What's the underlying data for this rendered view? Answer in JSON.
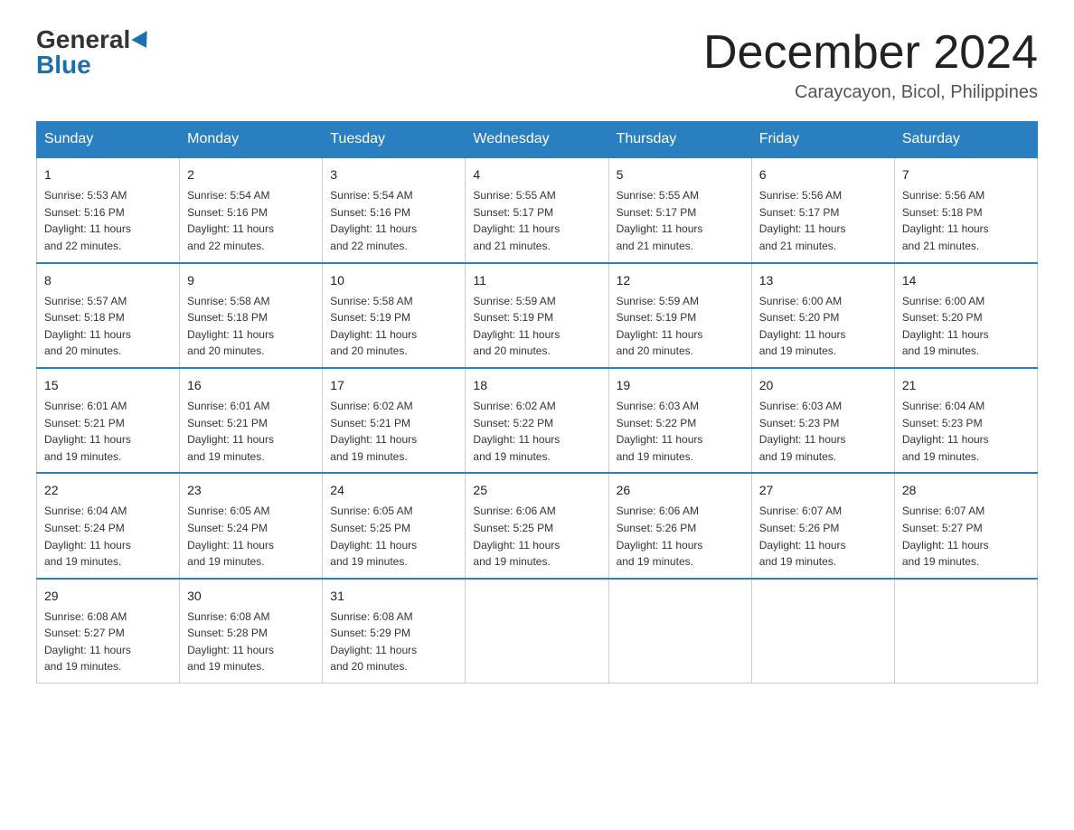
{
  "logo": {
    "general": "General",
    "blue": "Blue"
  },
  "title": "December 2024",
  "location": "Caraycayon, Bicol, Philippines",
  "days_of_week": [
    "Sunday",
    "Monday",
    "Tuesday",
    "Wednesday",
    "Thursday",
    "Friday",
    "Saturday"
  ],
  "weeks": [
    [
      {
        "day": "1",
        "sunrise": "5:53 AM",
        "sunset": "5:16 PM",
        "daylight": "11 hours and 22 minutes."
      },
      {
        "day": "2",
        "sunrise": "5:54 AM",
        "sunset": "5:16 PM",
        "daylight": "11 hours and 22 minutes."
      },
      {
        "day": "3",
        "sunrise": "5:54 AM",
        "sunset": "5:16 PM",
        "daylight": "11 hours and 22 minutes."
      },
      {
        "day": "4",
        "sunrise": "5:55 AM",
        "sunset": "5:17 PM",
        "daylight": "11 hours and 21 minutes."
      },
      {
        "day": "5",
        "sunrise": "5:55 AM",
        "sunset": "5:17 PM",
        "daylight": "11 hours and 21 minutes."
      },
      {
        "day": "6",
        "sunrise": "5:56 AM",
        "sunset": "5:17 PM",
        "daylight": "11 hours and 21 minutes."
      },
      {
        "day": "7",
        "sunrise": "5:56 AM",
        "sunset": "5:18 PM",
        "daylight": "11 hours and 21 minutes."
      }
    ],
    [
      {
        "day": "8",
        "sunrise": "5:57 AM",
        "sunset": "5:18 PM",
        "daylight": "11 hours and 20 minutes."
      },
      {
        "day": "9",
        "sunrise": "5:58 AM",
        "sunset": "5:18 PM",
        "daylight": "11 hours and 20 minutes."
      },
      {
        "day": "10",
        "sunrise": "5:58 AM",
        "sunset": "5:19 PM",
        "daylight": "11 hours and 20 minutes."
      },
      {
        "day": "11",
        "sunrise": "5:59 AM",
        "sunset": "5:19 PM",
        "daylight": "11 hours and 20 minutes."
      },
      {
        "day": "12",
        "sunrise": "5:59 AM",
        "sunset": "5:19 PM",
        "daylight": "11 hours and 20 minutes."
      },
      {
        "day": "13",
        "sunrise": "6:00 AM",
        "sunset": "5:20 PM",
        "daylight": "11 hours and 19 minutes."
      },
      {
        "day": "14",
        "sunrise": "6:00 AM",
        "sunset": "5:20 PM",
        "daylight": "11 hours and 19 minutes."
      }
    ],
    [
      {
        "day": "15",
        "sunrise": "6:01 AM",
        "sunset": "5:21 PM",
        "daylight": "11 hours and 19 minutes."
      },
      {
        "day": "16",
        "sunrise": "6:01 AM",
        "sunset": "5:21 PM",
        "daylight": "11 hours and 19 minutes."
      },
      {
        "day": "17",
        "sunrise": "6:02 AM",
        "sunset": "5:21 PM",
        "daylight": "11 hours and 19 minutes."
      },
      {
        "day": "18",
        "sunrise": "6:02 AM",
        "sunset": "5:22 PM",
        "daylight": "11 hours and 19 minutes."
      },
      {
        "day": "19",
        "sunrise": "6:03 AM",
        "sunset": "5:22 PM",
        "daylight": "11 hours and 19 minutes."
      },
      {
        "day": "20",
        "sunrise": "6:03 AM",
        "sunset": "5:23 PM",
        "daylight": "11 hours and 19 minutes."
      },
      {
        "day": "21",
        "sunrise": "6:04 AM",
        "sunset": "5:23 PM",
        "daylight": "11 hours and 19 minutes."
      }
    ],
    [
      {
        "day": "22",
        "sunrise": "6:04 AM",
        "sunset": "5:24 PM",
        "daylight": "11 hours and 19 minutes."
      },
      {
        "day": "23",
        "sunrise": "6:05 AM",
        "sunset": "5:24 PM",
        "daylight": "11 hours and 19 minutes."
      },
      {
        "day": "24",
        "sunrise": "6:05 AM",
        "sunset": "5:25 PM",
        "daylight": "11 hours and 19 minutes."
      },
      {
        "day": "25",
        "sunrise": "6:06 AM",
        "sunset": "5:25 PM",
        "daylight": "11 hours and 19 minutes."
      },
      {
        "day": "26",
        "sunrise": "6:06 AM",
        "sunset": "5:26 PM",
        "daylight": "11 hours and 19 minutes."
      },
      {
        "day": "27",
        "sunrise": "6:07 AM",
        "sunset": "5:26 PM",
        "daylight": "11 hours and 19 minutes."
      },
      {
        "day": "28",
        "sunrise": "6:07 AM",
        "sunset": "5:27 PM",
        "daylight": "11 hours and 19 minutes."
      }
    ],
    [
      {
        "day": "29",
        "sunrise": "6:08 AM",
        "sunset": "5:27 PM",
        "daylight": "11 hours and 19 minutes."
      },
      {
        "day": "30",
        "sunrise": "6:08 AM",
        "sunset": "5:28 PM",
        "daylight": "11 hours and 19 minutes."
      },
      {
        "day": "31",
        "sunrise": "6:08 AM",
        "sunset": "5:29 PM",
        "daylight": "11 hours and 20 minutes."
      },
      {
        "day": "",
        "sunrise": "",
        "sunset": "",
        "daylight": ""
      },
      {
        "day": "",
        "sunrise": "",
        "sunset": "",
        "daylight": ""
      },
      {
        "day": "",
        "sunrise": "",
        "sunset": "",
        "daylight": ""
      },
      {
        "day": "",
        "sunrise": "",
        "sunset": "",
        "daylight": ""
      }
    ]
  ]
}
